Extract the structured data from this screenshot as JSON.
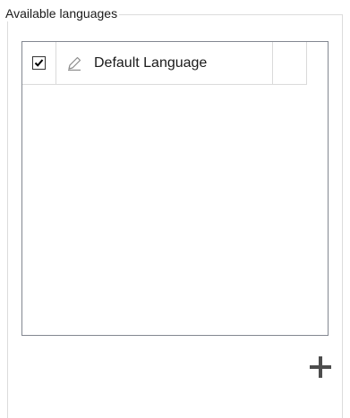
{
  "group": {
    "title": "Available languages"
  },
  "languages": [
    {
      "label": "Default Language",
      "checked": true
    }
  ],
  "icons": {
    "checkbox": "checkmark-icon",
    "edit": "pencil-icon",
    "add": "plus-icon"
  }
}
